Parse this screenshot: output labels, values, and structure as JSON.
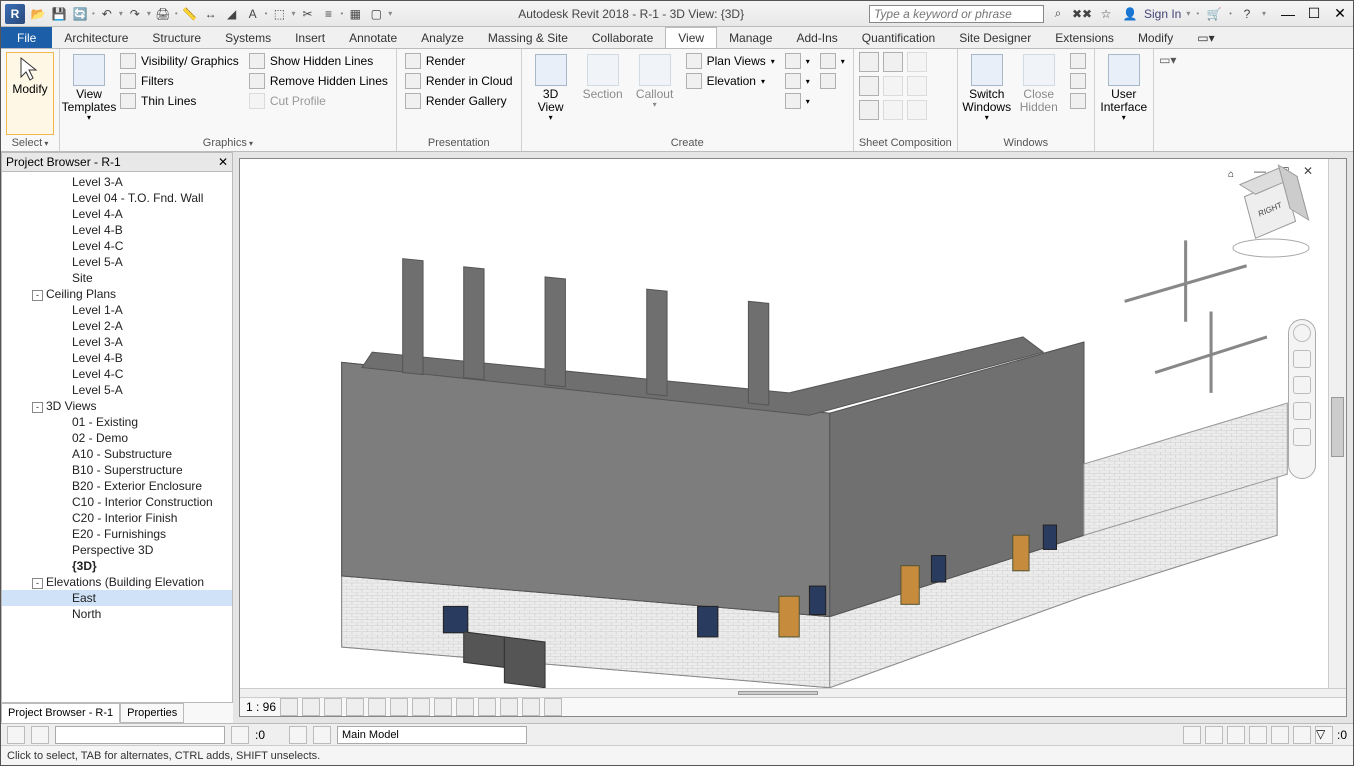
{
  "app_logo": "R",
  "title": "Autodesk Revit 2018 -     R-1 - 3D View: {3D}",
  "search_placeholder": "Type a keyword or phrase",
  "signin": "Sign In",
  "tabs": {
    "file": "File",
    "items": [
      "Architecture",
      "Structure",
      "Systems",
      "Insert",
      "Annotate",
      "Analyze",
      "Massing & Site",
      "Collaborate",
      "View",
      "Manage",
      "Add-Ins",
      "Quantification",
      "Site Designer",
      "Extensions",
      "Modify"
    ],
    "active": "View"
  },
  "ribbon": {
    "select": {
      "modify": "Modify",
      "label": "Select"
    },
    "graphics": {
      "templates": "View\nTemplates",
      "vis": "Visibility/ Graphics",
      "filters": "Filters",
      "thin": "Thin  Lines",
      "showhidden": "Show  Hidden Lines",
      "remhidden": "Remove  Hidden Lines",
      "cutprof": "Cut  Profile",
      "label": "Graphics"
    },
    "present": {
      "render": "Render",
      "cloud": "Render  in Cloud",
      "gallery": "Render  Gallery",
      "label": "Presentation"
    },
    "create": {
      "3d": "3D\nView",
      "section": "Section",
      "callout": "Callout",
      "plan": "Plan  Views",
      "elev": "Elevation",
      "label": "Create"
    },
    "sheet": {
      "label": "Sheet Composition"
    },
    "windows": {
      "switch": "Switch\nWindows",
      "close": "Close\nHidden",
      "label": "Windows"
    },
    "ui": {
      "user": "User\nInterface"
    }
  },
  "project_browser": {
    "title": "Project Browser - R-1",
    "items": [
      {
        "t": "Level 3-A",
        "i": 2
      },
      {
        "t": "Level 04 - T.O. Fnd. Wall",
        "i": 2
      },
      {
        "t": "Level 4-A",
        "i": 2
      },
      {
        "t": "Level 4-B",
        "i": 2
      },
      {
        "t": "Level 4-C",
        "i": 2
      },
      {
        "t": "Level 5-A",
        "i": 2
      },
      {
        "t": "Site",
        "i": 2
      },
      {
        "t": "Ceiling Plans",
        "i": 1,
        "exp": "-"
      },
      {
        "t": "Level 1-A",
        "i": 2
      },
      {
        "t": "Level 2-A",
        "i": 2
      },
      {
        "t": "Level 3-A",
        "i": 2
      },
      {
        "t": "Level 4-B",
        "i": 2
      },
      {
        "t": "Level 4-C",
        "i": 2
      },
      {
        "t": "Level 5-A",
        "i": 2
      },
      {
        "t": "3D Views",
        "i": 1,
        "exp": "-"
      },
      {
        "t": "01 - Existing",
        "i": 2
      },
      {
        "t": "02 - Demo",
        "i": 2
      },
      {
        "t": "A10 - Substructure",
        "i": 2
      },
      {
        "t": "B10 - Superstructure",
        "i": 2
      },
      {
        "t": "B20 - Exterior Enclosure",
        "i": 2
      },
      {
        "t": "C10 - Interior Construction",
        "i": 2
      },
      {
        "t": "C20 - Interior Finish",
        "i": 2
      },
      {
        "t": "E20 - Furnishings",
        "i": 2
      },
      {
        "t": "Perspective 3D",
        "i": 2
      },
      {
        "t": "{3D}",
        "i": 2,
        "bold": true
      },
      {
        "t": "Elevations (Building Elevation",
        "i": 1,
        "exp": "-"
      },
      {
        "t": "East",
        "i": 2,
        "sel": true
      },
      {
        "t": "North",
        "i": 2
      }
    ],
    "tab1": "Project Browser - R-1",
    "tab2": "Properties"
  },
  "view_controls": {
    "scale": "1 : 96"
  },
  "statusbar": {
    "mainmodel": "Main Model",
    "zero": ":0",
    "filterzero": ":0"
  },
  "hint": "Click to select, TAB for alternates, CTRL adds, SHIFT unselects.",
  "viewcube": {
    "face": "RIGHT"
  }
}
